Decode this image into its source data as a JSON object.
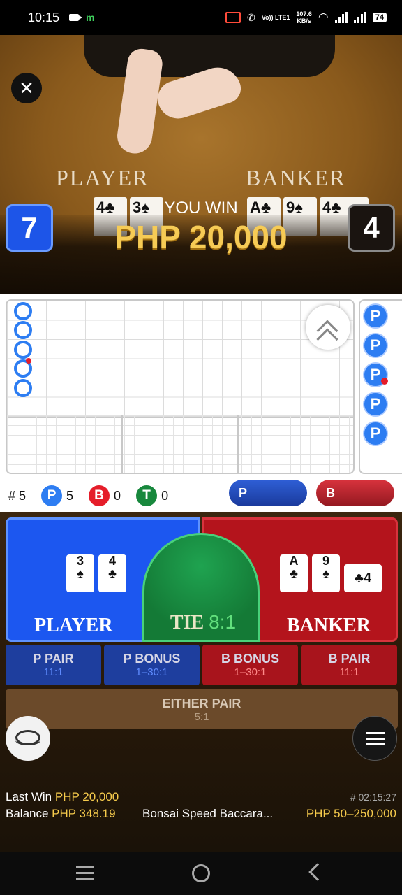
{
  "status_bar": {
    "time": "10:15",
    "app_indicator": "m",
    "net_label": "Vo)) LTE1",
    "network_speed": "107.6",
    "network_unit": "KB/s",
    "battery": "74",
    "icons": [
      "video-icon",
      "cast-icon",
      "call-icon",
      "wifi-icon",
      "signal-icon",
      "battery-icon"
    ]
  },
  "video": {
    "player_label": "PLAYER",
    "banker_label": "BANKER",
    "player_cards": [
      "4♣",
      "3♠"
    ],
    "banker_cards": [
      "A♣",
      "9♠",
      "4♣"
    ],
    "player_score": "7",
    "banker_score": "4",
    "win_text": "YOU WIN",
    "win_amount": "PHP 20,000"
  },
  "roadmap": {
    "side_road_label": "P",
    "stats": {
      "total_label": "# 5",
      "player_badge": "P",
      "player_count": "5",
      "banker_badge": "B",
      "banker_count": "0",
      "tie_badge": "T",
      "tie_count": "0"
    },
    "predict_player": "P",
    "predict_banker": "B"
  },
  "betting": {
    "player": {
      "label": "PLAYER",
      "cards": [
        {
          "rank": "3",
          "suit": "♠"
        },
        {
          "rank": "4",
          "suit": "♣"
        }
      ]
    },
    "tie": {
      "label": "TIE",
      "odds": "8:1"
    },
    "banker": {
      "label": "BANKER",
      "cards": [
        {
          "rank": "A",
          "suit": "♣"
        },
        {
          "rank": "9",
          "suit": "♠"
        }
      ],
      "side_card": "♣4"
    },
    "side_bets": [
      {
        "name": "P PAIR",
        "odds": "11:1"
      },
      {
        "name": "P BONUS",
        "odds": "1–30:1"
      },
      {
        "name": "B BONUS",
        "odds": "1–30:1"
      },
      {
        "name": "B PAIR",
        "odds": "11:1"
      }
    ],
    "either_pair": {
      "name": "EITHER PAIR",
      "odds": "5:1"
    }
  },
  "info": {
    "last_win_label": "Last Win",
    "last_win_value": "PHP 20,000",
    "balance_label": "Balance",
    "balance_value": "PHP 348.19",
    "round_id": "# 02:15:27",
    "table_name": "Bonsai Speed Baccara...",
    "limits": "PHP 50–250,000"
  },
  "colors": {
    "player_blue": "#1c57f0",
    "banker_red": "#b4141c",
    "tie_green": "#18883d",
    "gold": "#f6cb55"
  }
}
